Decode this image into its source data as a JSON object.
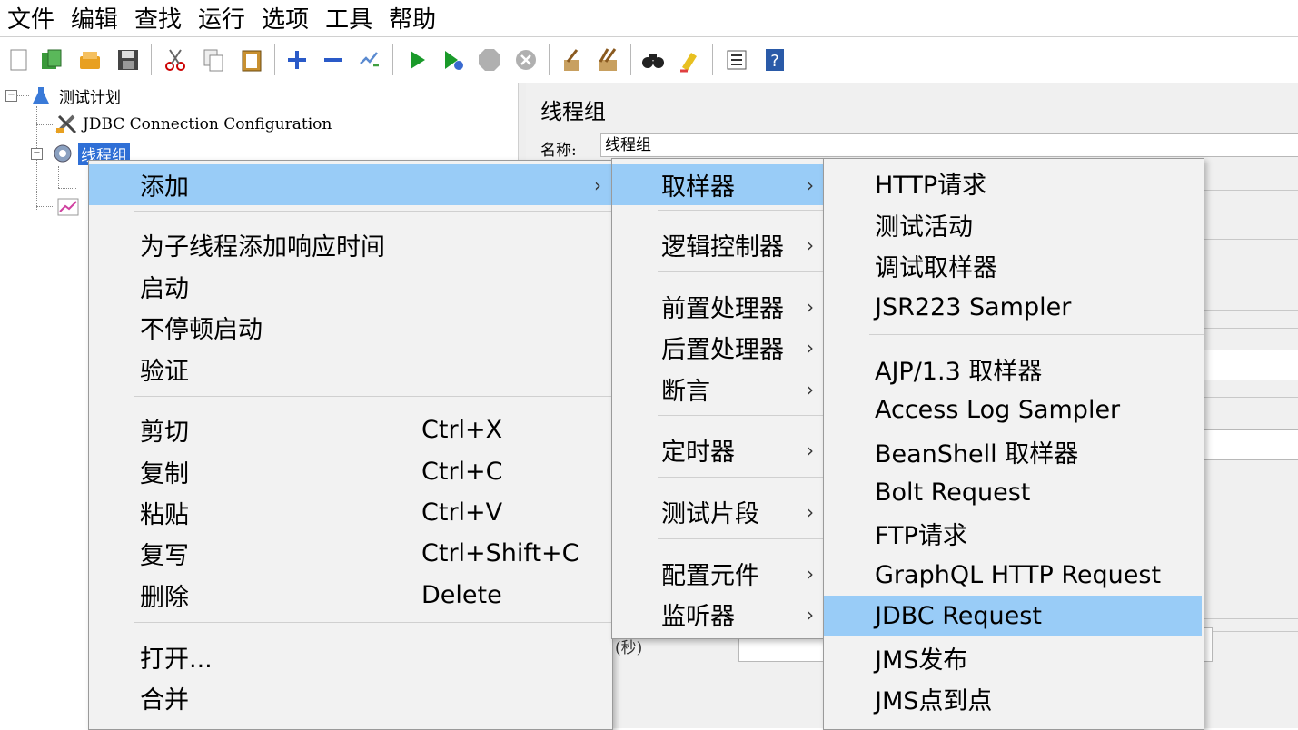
{
  "menubar": [
    "文件",
    "编辑",
    "查找",
    "运行",
    "选项",
    "工具",
    "帮助"
  ],
  "toolbar_icons": [
    "new-icon",
    "templates-icon",
    "open-icon",
    "save-icon",
    "cut-icon",
    "copy-icon",
    "paste-icon",
    "expand-icon",
    "collapse-icon",
    "toggle-icon",
    "start-icon",
    "start-no-pause-icon",
    "stop-icon",
    "shutdown-icon",
    "clear-icon",
    "clear-all-icon",
    "search-icon",
    "reset-search-icon",
    "function-helper-icon",
    "help-icon"
  ],
  "tree": {
    "root": "测试计划",
    "jdbc": "JDBC Connection Configuration",
    "thread_group": "线程组"
  },
  "panel": {
    "title": "线程组",
    "name_label": "名称:",
    "name_value": "线程组",
    "partial_label": "(秒)"
  },
  "context_menu": {
    "add": "添加",
    "add_think_time": "为子线程添加响应时间",
    "start": "启动",
    "start_no_pause": "不停顿启动",
    "validate": "验证",
    "cut": "剪切",
    "cut_shortcut": "Ctrl+X",
    "copy": "复制",
    "copy_shortcut": "Ctrl+C",
    "paste": "粘贴",
    "paste_shortcut": "Ctrl+V",
    "duplicate": "复写",
    "duplicate_shortcut": "Ctrl+Shift+C",
    "delete": "删除",
    "delete_shortcut": "Delete",
    "open": "打开...",
    "merge": "合并"
  },
  "add_submenu": {
    "sampler": "取样器",
    "logic_controller": "逻辑控制器",
    "pre_processor": "前置处理器",
    "post_processor": "后置处理器",
    "assertion": "断言",
    "timer": "定时器",
    "test_fragment": "测试片段",
    "config_element": "配置元件",
    "listener": "监听器"
  },
  "sampler_submenu": {
    "http": "HTTP请求",
    "test_action": "测试活动",
    "debug_sampler": "调试取样器",
    "jsr223": "JSR223 Sampler",
    "ajp": "AJP/1.3 取样器",
    "access_log": "Access Log Sampler",
    "beanshell": "BeanShell 取样器",
    "bolt": "Bolt Request",
    "ftp": "FTP请求",
    "graphql": "GraphQL HTTP Request",
    "jdbc": "JDBC Request",
    "jms_publish": "JMS发布",
    "jms_p2p": "JMS点到点"
  },
  "arrow_glyph": "›",
  "colors": {
    "highlight": "#99ccf7",
    "selection": "#2f6fd6",
    "menu_bg": "#f2f2f2"
  }
}
